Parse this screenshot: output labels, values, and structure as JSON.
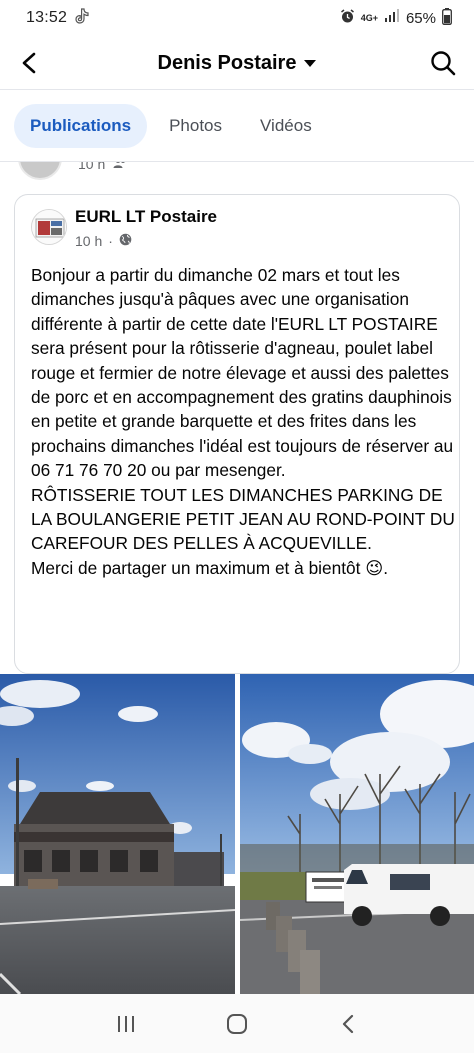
{
  "status_bar": {
    "time": "13:52",
    "network_label": "4G+",
    "battery_percent": "65%",
    "icons": [
      "tiktok-icon",
      "alarm-icon",
      "signal-icon",
      "battery-icon"
    ]
  },
  "header": {
    "title": "Denis Postaire",
    "icons": [
      "back-arrow-icon",
      "caret-down-icon",
      "search-icon"
    ]
  },
  "tabs": [
    {
      "label": "Publications",
      "active": true
    },
    {
      "label": "Photos",
      "active": false
    },
    {
      "label": "Vidéos",
      "active": false
    }
  ],
  "previous_post": {
    "time": "10 h",
    "audience_icon": "friends-icon"
  },
  "post": {
    "author": "EURL LT Postaire",
    "time": "10 h",
    "separator": "·",
    "audience_icon": "globe-icon",
    "text": "Bonjour a partir du dimanche 02 mars  et tout les dimanches jusqu'à pâques avec une organisation différente à partir de cette date l'EURL LT POSTAIRE sera présent pour la rôtisserie d'agneau, poulet label rouge et fermier de notre élevage et aussi des palettes de porc et en accompagnement des gratins dauphinois en petite et grande barquette et des frites dans les prochains dimanches l'idéal est toujours de réserver au 06 71 76 70 20 ou par mesenger.\nRÔTISSERIE TOUT LES DIMANCHES PARKING DE LA BOULANGERIE PETIT JEAN AU ROND-POINT DU CAREFOUR DES PELLES À ACQUEVILLE.\nMerci de partager un maximum et à bientôt 😉.",
    "photos": [
      {
        "name": "photo-building-parking"
      },
      {
        "name": "photo-van-parking",
        "sign_text": "RÔTISSERIE D'AGNEAU"
      }
    ]
  },
  "nav_bar": {
    "icons": [
      "recent-apps-icon",
      "home-icon",
      "back-icon"
    ]
  },
  "colors": {
    "accent": "#1b5bbf",
    "active_tab_bg": "#e7f0fd",
    "muted_text": "#65676b"
  }
}
